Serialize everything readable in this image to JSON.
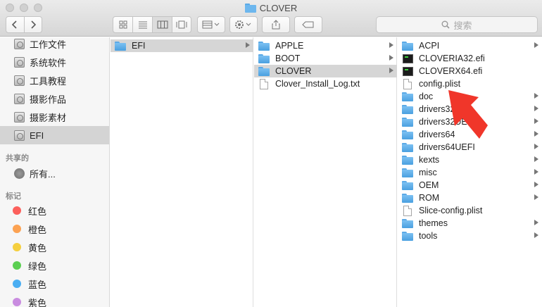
{
  "window": {
    "title": "CLOVER"
  },
  "toolbar": {
    "search_placeholder": "搜索",
    "icons": [
      "chevron-left-icon",
      "chevron-right-icon",
      "icon-view-icon",
      "list-view-icon",
      "column-view-icon",
      "gallery-view-icon",
      "group-icon",
      "gear-icon",
      "share-icon",
      "tag-icon"
    ]
  },
  "sidebar": {
    "items": [
      {
        "label": "工作文件",
        "icon": "disk-icon"
      },
      {
        "label": "系统软件",
        "icon": "disk-icon"
      },
      {
        "label": "工具教程",
        "icon": "disk-icon"
      },
      {
        "label": "摄影作品",
        "icon": "disk-icon"
      },
      {
        "label": "摄影素材",
        "icon": "disk-icon"
      },
      {
        "label": "EFI",
        "icon": "disk-icon",
        "selected": true
      }
    ],
    "shared_header": "共享的",
    "shared_items": [
      {
        "label": "所有...",
        "icon": "network-icon"
      }
    ],
    "tags_header": "标记",
    "tags": [
      {
        "label": "红色",
        "color": "#fc605c"
      },
      {
        "label": "橙色",
        "color": "#fca252"
      },
      {
        "label": "黄色",
        "color": "#f5cf3e"
      },
      {
        "label": "绿色",
        "color": "#5ccf52"
      },
      {
        "label": "蓝色",
        "color": "#4aaef2"
      },
      {
        "label": "紫色",
        "color": "#c98ce0"
      }
    ]
  },
  "columns": [
    {
      "items": [
        {
          "label": "EFI",
          "type": "folder",
          "selected": true,
          "arrow": true
        }
      ]
    },
    {
      "items": [
        {
          "label": "APPLE",
          "type": "folder",
          "arrow": true
        },
        {
          "label": "BOOT",
          "type": "folder",
          "arrow": true
        },
        {
          "label": "CLOVER",
          "type": "folder",
          "selected": true,
          "arrow": true
        },
        {
          "label": "Clover_Install_Log.txt",
          "type": "doc"
        }
      ]
    },
    {
      "items": [
        {
          "label": "ACPI",
          "type": "folder",
          "arrow": true
        },
        {
          "label": "CLOVERIA32.efi",
          "type": "efi"
        },
        {
          "label": "CLOVERX64.efi",
          "type": "efi"
        },
        {
          "label": "config.plist",
          "type": "doc"
        },
        {
          "label": "doc",
          "type": "folder",
          "arrow": true
        },
        {
          "label": "drivers32",
          "type": "folder",
          "arrow": true
        },
        {
          "label": "drivers32UEFI",
          "type": "folder",
          "arrow": true
        },
        {
          "label": "drivers64",
          "type": "folder",
          "arrow": true
        },
        {
          "label": "drivers64UEFI",
          "type": "folder",
          "arrow": true
        },
        {
          "label": "kexts",
          "type": "folder",
          "arrow": true
        },
        {
          "label": "misc",
          "type": "folder",
          "arrow": true
        },
        {
          "label": "OEM",
          "type": "folder",
          "arrow": true
        },
        {
          "label": "ROM",
          "type": "folder",
          "arrow": true
        },
        {
          "label": "Slice-config.plist",
          "type": "doc"
        },
        {
          "label": "themes",
          "type": "folder",
          "arrow": true
        },
        {
          "label": "tools",
          "type": "folder",
          "arrow": true
        }
      ]
    }
  ],
  "annotation": {
    "arrow_color": "#f0362a",
    "points_to": "config.plist"
  }
}
